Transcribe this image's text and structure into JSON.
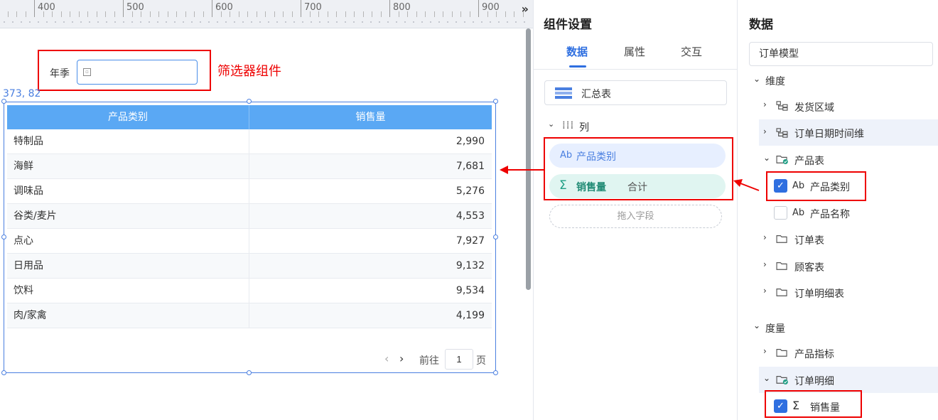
{
  "ruler": {
    "labels": [
      "400",
      "500",
      "600",
      "700",
      "800",
      "900"
    ],
    "expand_icon": "double-chevron-right-icon"
  },
  "filter": {
    "label": "年季",
    "annotation": "筛选器组件",
    "icon": "calendar-icon"
  },
  "coord_label": "373, 82",
  "table": {
    "headers": [
      "产品类别",
      "销售量"
    ],
    "rows": [
      {
        "category": "特制品",
        "value": "2,990"
      },
      {
        "category": "海鲜",
        "value": "7,681"
      },
      {
        "category": "调味品",
        "value": "5,276"
      },
      {
        "category": "谷类/麦片",
        "value": "4,553"
      },
      {
        "category": "点心",
        "value": "7,927"
      },
      {
        "category": "日用品",
        "value": "9,132"
      },
      {
        "category": "饮料",
        "value": "9,534"
      },
      {
        "category": "肉/家禽",
        "value": "4,199"
      }
    ],
    "pager": {
      "goto": "前往",
      "page": "1",
      "unit": "页"
    }
  },
  "settings": {
    "title": "组件设置",
    "tabs": [
      "数据",
      "属性",
      "交互"
    ],
    "active_tab": "数据",
    "chart_type": "汇总表",
    "column_section": "列",
    "fields": {
      "category_label": "产品类别",
      "category_icon_text": "Ab",
      "sales_label": "销售量",
      "sales_agg": "合计",
      "sales_icon": "Σ"
    },
    "drop_placeholder": "拖入字段"
  },
  "data": {
    "title": "数据",
    "model": "订单模型",
    "dimension_label": "维度",
    "measure_label": "度量",
    "dimension_tree": {
      "ship_region": "发货区域",
      "order_date_dim": "订单日期时间维",
      "product_table": "产品表",
      "product_category": "产品类别",
      "product_name": "产品名称",
      "order_table": "订单表",
      "customer_table": "顾客表",
      "order_detail_table": "订单明细表"
    },
    "measure_tree": {
      "product_metrics": "产品指标",
      "order_detail": "订单明细",
      "sales": "销售量"
    },
    "type_icon_text": "Ab",
    "sigma": "Σ",
    "check": "✓",
    "collapsed": "›",
    "expanded": "⌄"
  },
  "colors": {
    "accent": "#2f6fe0",
    "table_header": "#5aa8f4",
    "annotation_red": "#e00000",
    "sales_green": "#1f9e85"
  }
}
